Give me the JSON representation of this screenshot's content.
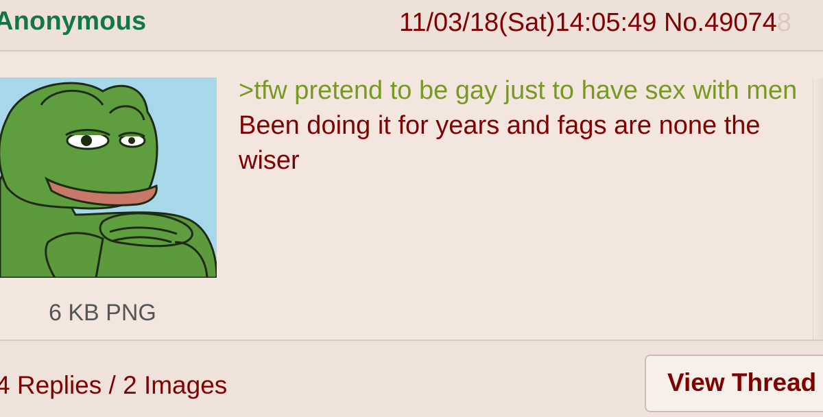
{
  "post": {
    "name": "Anonymous",
    "datetime": "11/03/18(Sat)14:05:49",
    "number": "No.49074",
    "number_faded": "8",
    "file": {
      "info": "6 KB PNG",
      "thumbnail": "frog-thumbnail"
    },
    "greentext": ">tfw pretend to be gay just to have sex with men",
    "body": "Been doing it for years and fags are none the wiser"
  },
  "footer": {
    "summary": "4 Replies / 2 Images",
    "view_thread_label": "View Thread"
  },
  "colors": {
    "name": "#117743",
    "meta": "#800000",
    "greentext": "#789922",
    "body_text": "#800000",
    "background": "#f2e6df"
  }
}
